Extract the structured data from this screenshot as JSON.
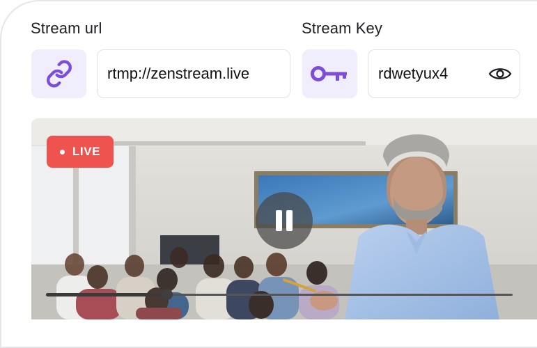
{
  "stream_url": {
    "label": "Stream url",
    "value": "rtmp://zenstream.live",
    "icon": "link-icon"
  },
  "stream_key": {
    "label": "Stream Key",
    "value": "rdwetyux4",
    "icon": "key-icon",
    "toggle_icon": "eye-icon"
  },
  "video": {
    "live_label": "LIVE",
    "control_icon": "pause-icon",
    "progress": 0.26
  },
  "colors": {
    "accent": "#7c4ddb",
    "accent_bg": "#f0edfd",
    "live": "#ef5350"
  }
}
